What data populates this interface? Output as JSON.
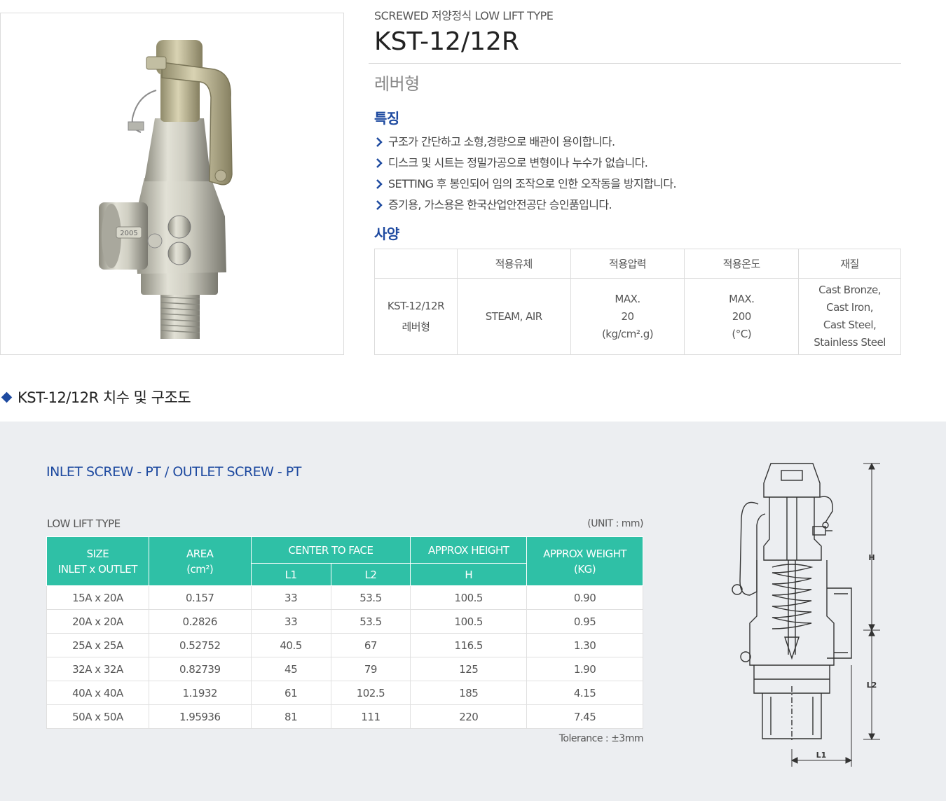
{
  "product": {
    "subtitle": "SCREWED 저양정식 LOW LIFT TYPE",
    "model": "KST-12/12R",
    "type_name": "레버형",
    "photo_badge": "2005"
  },
  "features_heading": "특징",
  "features": [
    "구조가 간단하고 소형,경량으로 배관이 용이합니다.",
    "디스크 및 시트는 정밀가공으로 변형이나 누수가 없습니다.",
    "SETTING 후 봉인되어 임의 조작으로 인한 오작동을 방지합니다.",
    "증기용, 가스용은 한국산업안전공단 승인품입니다."
  ],
  "spec_heading": "사양",
  "spec_table": {
    "headers": [
      "",
      "적용유체",
      "적용압력",
      "적용온도",
      "재질"
    ],
    "row": {
      "model_line1": "KST-12/12R",
      "model_line2": "레버형",
      "fluid": "STEAM, AIR",
      "pressure_line1": "MAX.",
      "pressure_line2": "20",
      "pressure_line3": "(kg/cm².g)",
      "temp_line1": "MAX.",
      "temp_line2": "200",
      "temp_line3": "(°C)",
      "material_line1": "Cast Bronze,",
      "material_line2": "Cast Iron,",
      "material_line3": "Cast Steel,",
      "material_line4": "Stainless Steel"
    }
  },
  "dimension": {
    "heading": "KST-12/12R 치수 및 구조도",
    "screw_title": "INLET SCREW - PT / OUTLET SCREW - PT",
    "table_caption": "LOW LIFT TYPE",
    "unit": "(UNIT : mm)",
    "tolerance": "Tolerance : ±3mm",
    "headers": {
      "size_line1": "SIZE",
      "size_line2": "INLET x OUTLET",
      "area_line1": "AREA",
      "area_line2": "(cm²)",
      "center_to_face": "CENTER TO FACE",
      "l1": "L1",
      "l2": "L2",
      "approx_height": "APPROX HEIGHT",
      "h": "H",
      "weight_line1": "APPROX WEIGHT",
      "weight_line2": "(KG)"
    },
    "rows": [
      [
        "15A x 20A",
        "0.157",
        "33",
        "53.5",
        "100.5",
        "0.90"
      ],
      [
        "20A x 20A",
        "0.2826",
        "33",
        "53.5",
        "100.5",
        "0.95"
      ],
      [
        "25A x 25A",
        "0.52752",
        "40.5",
        "67",
        "116.5",
        "1.30"
      ],
      [
        "32A x 32A",
        "0.82739",
        "45",
        "79",
        "125",
        "1.90"
      ],
      [
        "40A x 40A",
        "1.1932",
        "61",
        "102.5",
        "185",
        "4.15"
      ],
      [
        "50A x 50A",
        "1.95936",
        "81",
        "111",
        "220",
        "7.45"
      ]
    ],
    "drawing_labels": {
      "h": "H",
      "l2": "L2",
      "l1": "L1"
    }
  },
  "colors": {
    "accent_blue": "#1e4aa0",
    "table_header_teal": "#2fc0a6",
    "panel_gray": "#eceef1"
  }
}
